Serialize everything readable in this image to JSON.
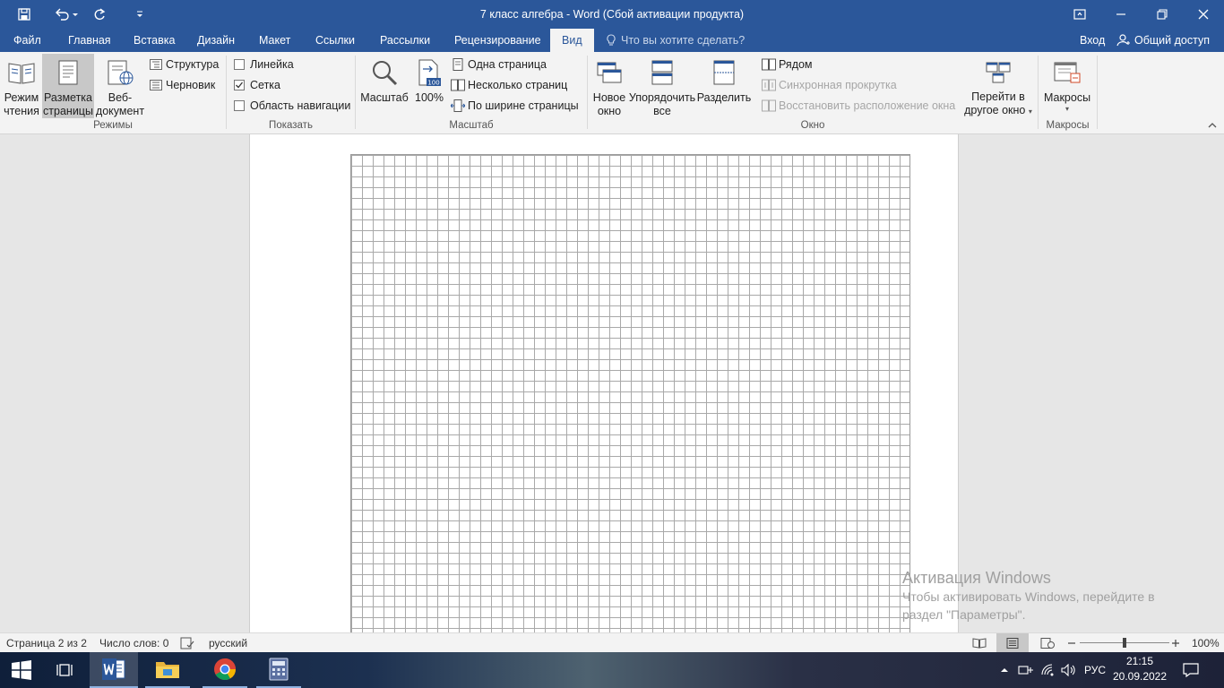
{
  "window": {
    "title": "7 класс алгебра - Word (Сбой активации продукта)"
  },
  "tabs": {
    "file": "Файл",
    "home": "Главная",
    "insert": "Вставка",
    "design": "Дизайн",
    "layout": "Макет",
    "references": "Ссылки",
    "mailings": "Рассылки",
    "review": "Рецензирование",
    "view": "Вид"
  },
  "tellme": {
    "placeholder": "Что вы хотите сделать?"
  },
  "account": {
    "signin": "Вход",
    "share": "Общий доступ"
  },
  "ribbon": {
    "modes": {
      "read_line1": "Режим",
      "read_line2": "чтения",
      "print_line1": "Разметка",
      "print_line2": "страницы",
      "web_line1": "Веб-",
      "web_line2": "документ",
      "outline": "Структура",
      "draft": "Черновик",
      "label": "Режимы"
    },
    "show": {
      "ruler": "Линейка",
      "ruler_checked": false,
      "gridlines": "Сетка",
      "gridlines_checked": true,
      "nav_pane": "Область навигации",
      "nav_checked": false,
      "label": "Показать"
    },
    "zoom": {
      "zoom_btn": "Масштаб",
      "hundred": "100%",
      "hundred_icon_text": "100",
      "one_page": "Одна страница",
      "multi_page": "Несколько страниц",
      "page_width": "По ширине страницы",
      "label": "Масштаб"
    },
    "window": {
      "new_line1": "Новое",
      "new_line2": "окно",
      "arrange_line1": "Упорядочить",
      "arrange_line2": "все",
      "split": "Разделить",
      "side_by_side": "Рядом",
      "sync_scroll": "Синхронная прокрутка",
      "reset_pos": "Восстановить расположение окна",
      "switch_line1": "Перейти в",
      "switch_line2": "другое окно",
      "label": "Окно"
    },
    "macros": {
      "btn": "Макросы",
      "label": "Макросы"
    }
  },
  "statusbar": {
    "page": "Страница 2 из 2",
    "words": "Число слов: 0",
    "language": "русский",
    "zoom": "100%",
    "zoom_fraction": 0.5
  },
  "watermark": {
    "title": "Активация Windows",
    "line1": "Чтобы активировать Windows, перейдите в",
    "line2": "раздел \"Параметры\"."
  },
  "taskbar": {
    "lang": "РУС",
    "time": "21:15",
    "date": "20.09.2022"
  },
  "colors": {
    "accent": "#2b579a",
    "ribbon_bg": "#f3f3f3",
    "doc_bg": "#e6e6e6"
  }
}
